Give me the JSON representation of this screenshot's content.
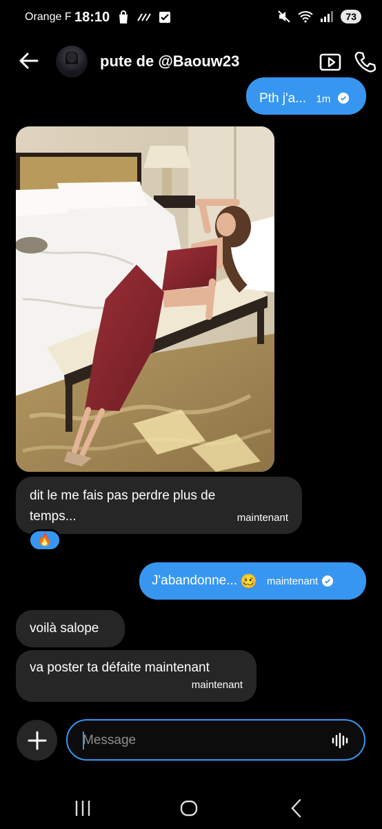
{
  "status_bar": {
    "carrier": "Orange F",
    "time": "18:10",
    "battery": "73",
    "icons": [
      "shopping-bag-icon",
      "data-saver-icon",
      "checkbox-icon",
      "mute-icon",
      "wifi-icon",
      "signal-icon"
    ]
  },
  "header": {
    "title": "pute de @Baouw23",
    "icons": [
      "back-arrow-icon",
      "video-call-icon",
      "phone-call-icon"
    ]
  },
  "messages": {
    "m0": {
      "text": "Pth j'a...",
      "time": "1m",
      "direction": "outgoing",
      "read": true
    },
    "m1": {
      "type": "image",
      "direction": "incoming"
    },
    "m2": {
      "line1": "dit le me fais pas perdre plus de",
      "line2": "temps...",
      "time": "maintenant",
      "direction": "incoming",
      "reaction": "🔥"
    },
    "m3": {
      "text": "J'abandonne...",
      "emoji": "🥴",
      "time": "maintenant",
      "direction": "outgoing",
      "read": true
    },
    "m4": {
      "text": "voilà salope",
      "direction": "incoming"
    },
    "m5": {
      "text": "va poster ta défaite maintenant",
      "time": "maintenant",
      "direction": "incoming"
    }
  },
  "composer": {
    "placeholder": "Message",
    "value": "",
    "icons": [
      "plus-icon",
      "voice-message-icon"
    ]
  },
  "nav": [
    "recent-apps-icon",
    "home-icon",
    "back-icon"
  ],
  "colors": {
    "accent": "#3797f0",
    "incoming_bubble": "#262626",
    "background": "#000000"
  }
}
